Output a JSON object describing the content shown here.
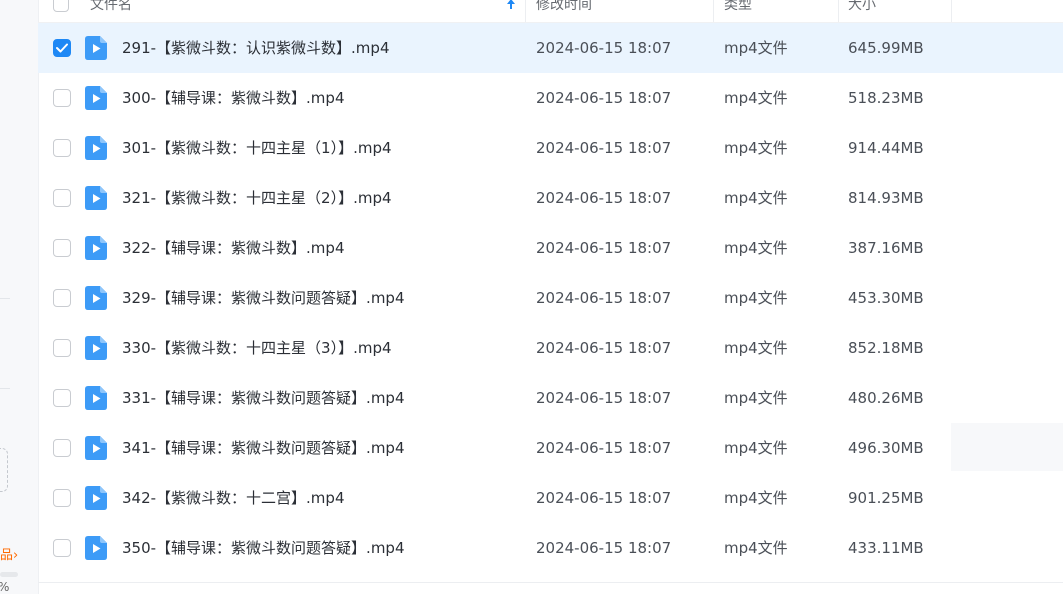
{
  "table": {
    "columns": {
      "name": "文件名",
      "modified": "修改时间",
      "type": "类型",
      "size": "大小"
    },
    "sort": {
      "column": "name",
      "icon": "sort-up-arrow-icon"
    },
    "rows": [
      {
        "name": "291-【紫微斗数：认识紫微斗数】.mp4",
        "modified": "2024-06-15 18:07",
        "type": "mp4文件",
        "size": "645.99MB",
        "checked": true
      },
      {
        "name": "300-【辅导课：紫微斗数】.mp4",
        "modified": "2024-06-15 18:07",
        "type": "mp4文件",
        "size": "518.23MB",
        "checked": false
      },
      {
        "name": "301-【紫微斗数：十四主星（1）】.mp4",
        "modified": "2024-06-15 18:07",
        "type": "mp4文件",
        "size": "914.44MB",
        "checked": false
      },
      {
        "name": "321-【紫微斗数：十四主星（2）】.mp4",
        "modified": "2024-06-15 18:07",
        "type": "mp4文件",
        "size": "814.93MB",
        "checked": false
      },
      {
        "name": "322-【辅导课：紫微斗数】.mp4",
        "modified": "2024-06-15 18:07",
        "type": "mp4文件",
        "size": "387.16MB",
        "checked": false
      },
      {
        "name": "329-【辅导课：紫微斗数问题答疑】.mp4",
        "modified": "2024-06-15 18:07",
        "type": "mp4文件",
        "size": "453.30MB",
        "checked": false
      },
      {
        "name": "330-【紫微斗数：十四主星（3）】.mp4",
        "modified": "2024-06-15 18:07",
        "type": "mp4文件",
        "size": "852.18MB",
        "checked": false
      },
      {
        "name": "331-【辅导课：紫微斗数问题答疑】.mp4",
        "modified": "2024-06-15 18:07",
        "type": "mp4文件",
        "size": "480.26MB",
        "checked": false
      },
      {
        "name": "341-【辅导课：紫微斗数问题答疑】.mp4",
        "modified": "2024-06-15 18:07",
        "type": "mp4文件",
        "size": "496.30MB",
        "checked": false
      },
      {
        "name": "342-【紫微斗数：十二宫】.mp4",
        "modified": "2024-06-15 18:07",
        "type": "mp4文件",
        "size": "901.25MB",
        "checked": false
      },
      {
        "name": "350-【辅导课：紫微斗数问题答疑】.mp4",
        "modified": "2024-06-15 18:07",
        "type": "mp4文件",
        "size": "433.11MB",
        "checked": false
      }
    ]
  },
  "sidebar": {
    "promo_text": "品",
    "promo_chevron": "›",
    "percent_text": "%"
  },
  "colors": {
    "accent": "#1e88f5",
    "selected_row": "#eaf4fe",
    "video_icon": "#3d9bf7",
    "promo": "#ff6a00"
  },
  "icons": {
    "file": "video-file-icon",
    "check": "checkmark-icon"
  }
}
